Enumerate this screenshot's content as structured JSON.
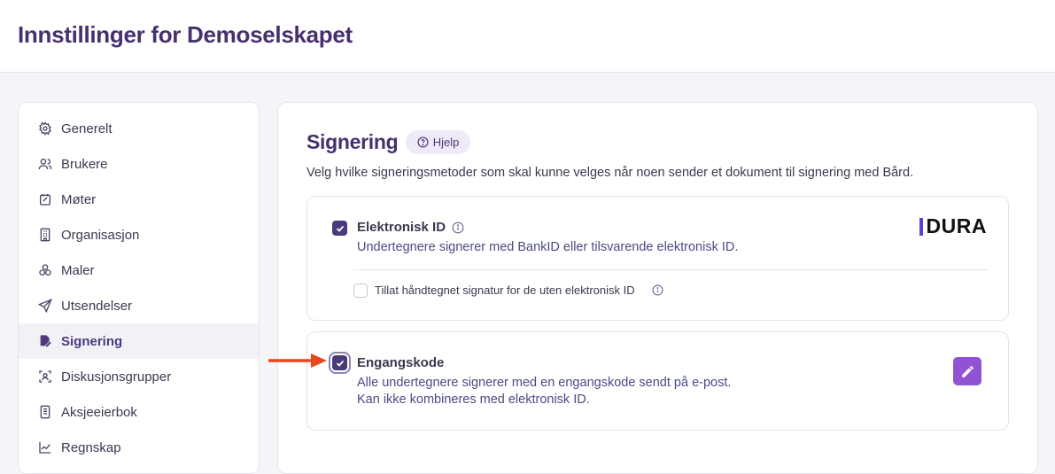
{
  "header": {
    "title": "Innstillinger for Demoselskapet"
  },
  "sidebar": {
    "items": [
      {
        "label": "Generelt",
        "icon": "gear-icon"
      },
      {
        "label": "Brukere",
        "icon": "users-icon"
      },
      {
        "label": "Møter",
        "icon": "calendar-icon"
      },
      {
        "label": "Organisasjon",
        "icon": "building-icon"
      },
      {
        "label": "Maler",
        "icon": "shapes-icon"
      },
      {
        "label": "Utsendelser",
        "icon": "send-icon"
      },
      {
        "label": "Signering",
        "icon": "signature-icon",
        "active": true
      },
      {
        "label": "Diskusjonsgrupper",
        "icon": "group-icon"
      },
      {
        "label": "Aksjeeierbok",
        "icon": "book-icon"
      },
      {
        "label": "Regnskap",
        "icon": "chart-icon"
      }
    ]
  },
  "main": {
    "title": "Signering",
    "help_label": "Hjelp",
    "description": "Velg hvilke signeringsmetoder som skal kunne velges når noen sender et dokument til signering med Bård.",
    "options": [
      {
        "title": "Elektronisk ID",
        "description": "Undertegnere signerer med BankID eller tilsvarende elektronisk ID.",
        "checked": true,
        "logo_text": "DURA",
        "sub_option": {
          "label": "Tillat håndtegnet signatur for de uten elektronisk ID",
          "checked": false
        }
      },
      {
        "title": "Engangskode",
        "description_line1": "Alle undertegnere signerer med en engangskode sendt på e-post.",
        "description_line2": "Kan ikke kombineres med elektronisk ID.",
        "checked": true
      }
    ]
  },
  "colors": {
    "accent": "#4b3a7a",
    "title": "#46306d",
    "edit_button": "#9152d4",
    "logo_bar": "#5b3fd6",
    "arrow": "#e8461e"
  }
}
